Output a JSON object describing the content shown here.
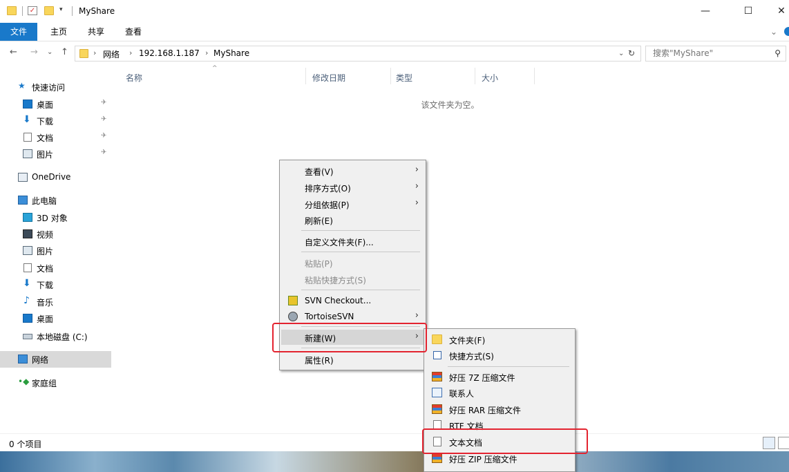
{
  "window": {
    "title": "MyShare",
    "controls": {
      "minimize": "—",
      "maximize": "☐",
      "close": "✕"
    }
  },
  "ribbon": {
    "tabs": [
      "文件",
      "主页",
      "共享",
      "查看"
    ],
    "expand_glyph": "⌄"
  },
  "address": {
    "back": "←",
    "forward": "→",
    "recent": "⌄",
    "up": "↑",
    "crumbs": [
      "网络",
      "192.168.1.187",
      "MyShare"
    ],
    "crumb_sep": "›",
    "dropdown": "⌄",
    "refresh": "↻",
    "search_placeholder": "搜索\"MyShare\"",
    "search_icon": "⚲"
  },
  "nav": {
    "quick_access": "快速访问",
    "quick_items": [
      "桌面",
      "下载",
      "文档",
      "图片"
    ],
    "pin_glyph": "✈",
    "onedrive": "OneDrive",
    "this_pc": "此电脑",
    "pc_items": [
      "3D 对象",
      "视频",
      "图片",
      "文档",
      "下载",
      "音乐",
      "桌面",
      "本地磁盘 (C:)"
    ],
    "network": "网络",
    "homegroup": "家庭组"
  },
  "content": {
    "columns": [
      "名称",
      "修改日期",
      "类型",
      "大小"
    ],
    "sort_glyph": "^",
    "empty_message": "该文件夹为空。"
  },
  "status": {
    "item_count": "0 个项目"
  },
  "context_menu": {
    "items": [
      {
        "label": "查看(V)",
        "submenu": true
      },
      {
        "label": "排序方式(O)",
        "submenu": true
      },
      {
        "label": "分组依据(P)",
        "submenu": true
      },
      {
        "label": "刷新(E)",
        "submenu": false
      },
      {
        "label": "自定义文件夹(F)...",
        "submenu": false
      },
      {
        "label": "粘贴(P)",
        "disabled": true
      },
      {
        "label": "粘贴快捷方式(S)",
        "disabled": true
      },
      {
        "label": "SVN Checkout...",
        "icon": "svn-checkout-icon"
      },
      {
        "label": "TortoiseSVN",
        "icon": "tortoisesvn-icon",
        "submenu": true
      },
      {
        "label": "新建(W)",
        "submenu": true,
        "highlighted": true
      },
      {
        "label": "属性(R)",
        "submenu": false
      }
    ],
    "arrow_glyph": "›"
  },
  "new_submenu": {
    "items": [
      {
        "label": "文件夹(F)",
        "icon": "folder-icon"
      },
      {
        "label": "快捷方式(S)",
        "icon": "shortcut-icon"
      },
      {
        "label": "好压 7Z 压缩文件",
        "icon": "archive-icon"
      },
      {
        "label": "联系人",
        "icon": "contact-icon"
      },
      {
        "label": "好压 RAR 压缩文件",
        "icon": "archive-icon"
      },
      {
        "label": "RTF 文档",
        "icon": "document-icon"
      },
      {
        "label": "文本文档",
        "icon": "text-document-icon",
        "highlighted": true
      },
      {
        "label": "好压 ZIP 压缩文件",
        "icon": "archive-icon"
      }
    ]
  },
  "colors": {
    "accent": "#1979ca",
    "highlight": "#e3232f",
    "folder": "#f9d65b"
  }
}
